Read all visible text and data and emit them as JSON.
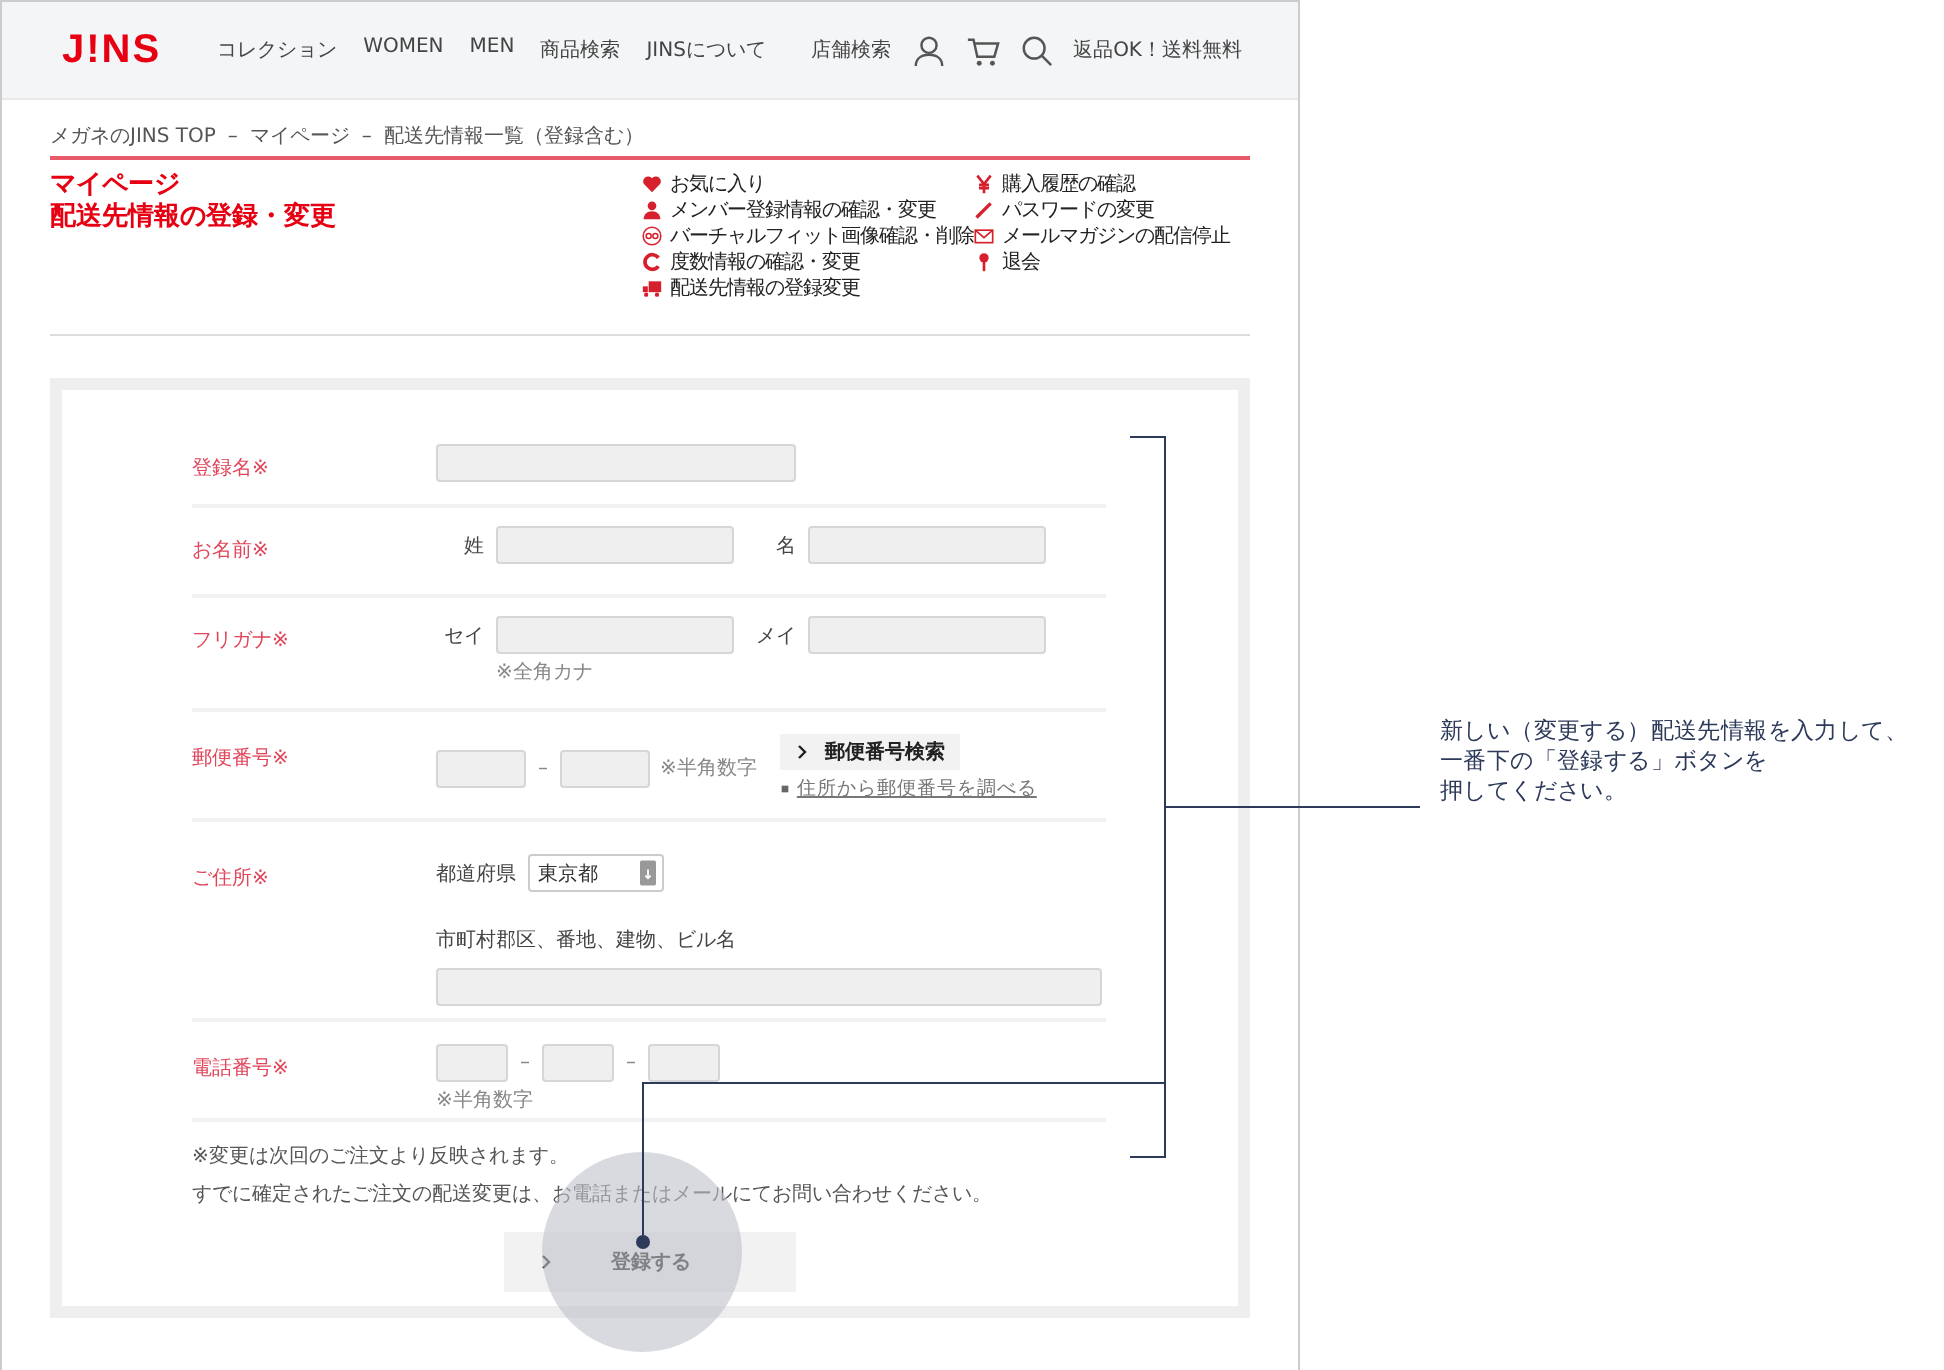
{
  "header": {
    "logo": "J!NS",
    "nav": [
      "コレクション",
      "WOMEN",
      "MEN",
      "商品検索",
      "JINSについて"
    ],
    "store_search": "店舗検索",
    "promo": "返品OK！送料無料"
  },
  "breadcrumb": {
    "separator": "–",
    "items": [
      "メガネのJINS TOP",
      "マイページ",
      "配送先情報一覧（登録含む）"
    ]
  },
  "title": [
    "マイページ",
    "配送先情報の登録・変更"
  ],
  "menu": [
    [
      {
        "label": "お気に入り",
        "kind": "heart"
      },
      {
        "label": "メンバー登録情報の確認・変更",
        "kind": "person"
      },
      {
        "label": "バーチャルフィット画像確認・削除",
        "kind": "glasses"
      },
      {
        "label": "度数情報の確認・変更",
        "kind": "c"
      },
      {
        "label": "配送先情報の登録変更",
        "kind": "truck"
      }
    ],
    [
      {
        "label": "購入履歴の確認",
        "kind": "yen"
      },
      {
        "label": "パスワードの変更",
        "kind": "pencil"
      },
      {
        "label": "メールマガジンの配信停止",
        "kind": "mail"
      },
      {
        "label": "退会",
        "kind": "pin"
      }
    ]
  ],
  "form": {
    "rows": [
      {
        "kind": "single",
        "label": "登録名※"
      },
      {
        "kind": "pair",
        "label": "お名前※",
        "fields": [
          "姓",
          "名"
        ]
      },
      {
        "kind": "pair",
        "label": "フリガナ※",
        "fields": [
          "セイ",
          "メイ"
        ],
        "note": "※全角カナ"
      },
      {
        "kind": "postal",
        "label": "郵便番号※",
        "separator": "–",
        "note": "※半角数字",
        "search_button": "郵便番号検索",
        "link": "住所から郵便番号を調べる"
      },
      {
        "kind": "address",
        "label": "ご住所※",
        "prefecture_label": "都道府県",
        "prefecture_value": "東京都",
        "street_label": "市町村郡区、番地、建物、ビル名"
      },
      {
        "kind": "phone",
        "label": "電話番号※",
        "separator": "–",
        "note": "※半角数字"
      }
    ],
    "notes": [
      "※変更は次回のご注文より反映されます。",
      "すでに確定されたご注文の配送変更は、お電話またはメールにてお問い合わせください。"
    ],
    "submit_button": "登録する"
  },
  "annotation": [
    "新しい（変更する）配送先情報を入力して、",
    "一番下の「登録する」ボタンを",
    "押してください。"
  ]
}
